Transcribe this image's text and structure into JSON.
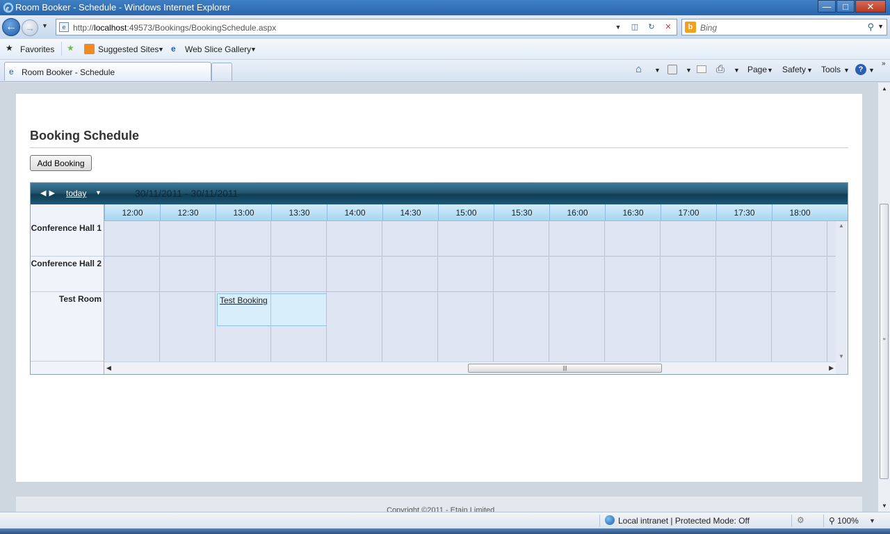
{
  "window": {
    "title": "Room Booker - Schedule - Windows Internet Explorer",
    "minimize": "—",
    "maximize": "□",
    "close": "✕"
  },
  "address": {
    "url_prefix": "http://",
    "url_host": "localhost",
    "url_rest": ":49573/Bookings/BookingSchedule.aspx",
    "search_placeholder": "Bing"
  },
  "favorites": {
    "favorites_label": "Favorites",
    "suggested_sites": "Suggested Sites",
    "web_slice_gallery": "Web Slice Gallery"
  },
  "tabs": {
    "active_tab": "Room Booker - Schedule"
  },
  "commands": {
    "page": "Page",
    "safety": "Safety",
    "tools": "Tools"
  },
  "page": {
    "heading": "Booking Schedule",
    "add_booking": "Add Booking",
    "footer": "Copyright ©2011 - Etain Limited"
  },
  "scheduler": {
    "today_label": "today",
    "date_range": "30/11/2011 - 30/11/2011",
    "times": [
      "12:00",
      "12:30",
      "13:00",
      "13:30",
      "14:00",
      "14:30",
      "15:00",
      "15:30",
      "16:00",
      "16:30",
      "17:00",
      "17:30",
      "18:00"
    ],
    "resources": [
      "Conference Hall 1",
      "Conference Hall 2",
      "Test Room"
    ],
    "booking": {
      "title": "Test Booking",
      "resource": "Test Room",
      "start": "13:00",
      "end": "14:00"
    }
  },
  "status": {
    "zone": "Local intranet | Protected Mode: Off",
    "zoom": "100%"
  },
  "icons": {
    "browser": "ie-icon",
    "back": "back-arrow-icon",
    "forward": "forward-arrow-icon",
    "search": "magnifier-icon",
    "favorites": "star-icon",
    "home": "home-icon",
    "feeds": "rss-icon",
    "mail": "mail-icon",
    "print": "printer-icon",
    "help": "help-icon"
  },
  "colors": {
    "title_bar": "#2a66ad",
    "scheduler_toolbar": "#24566f",
    "time_header": "#a8d6f1",
    "grid_background": "#dfe5f3",
    "booking_fill": "#d9eefb"
  }
}
